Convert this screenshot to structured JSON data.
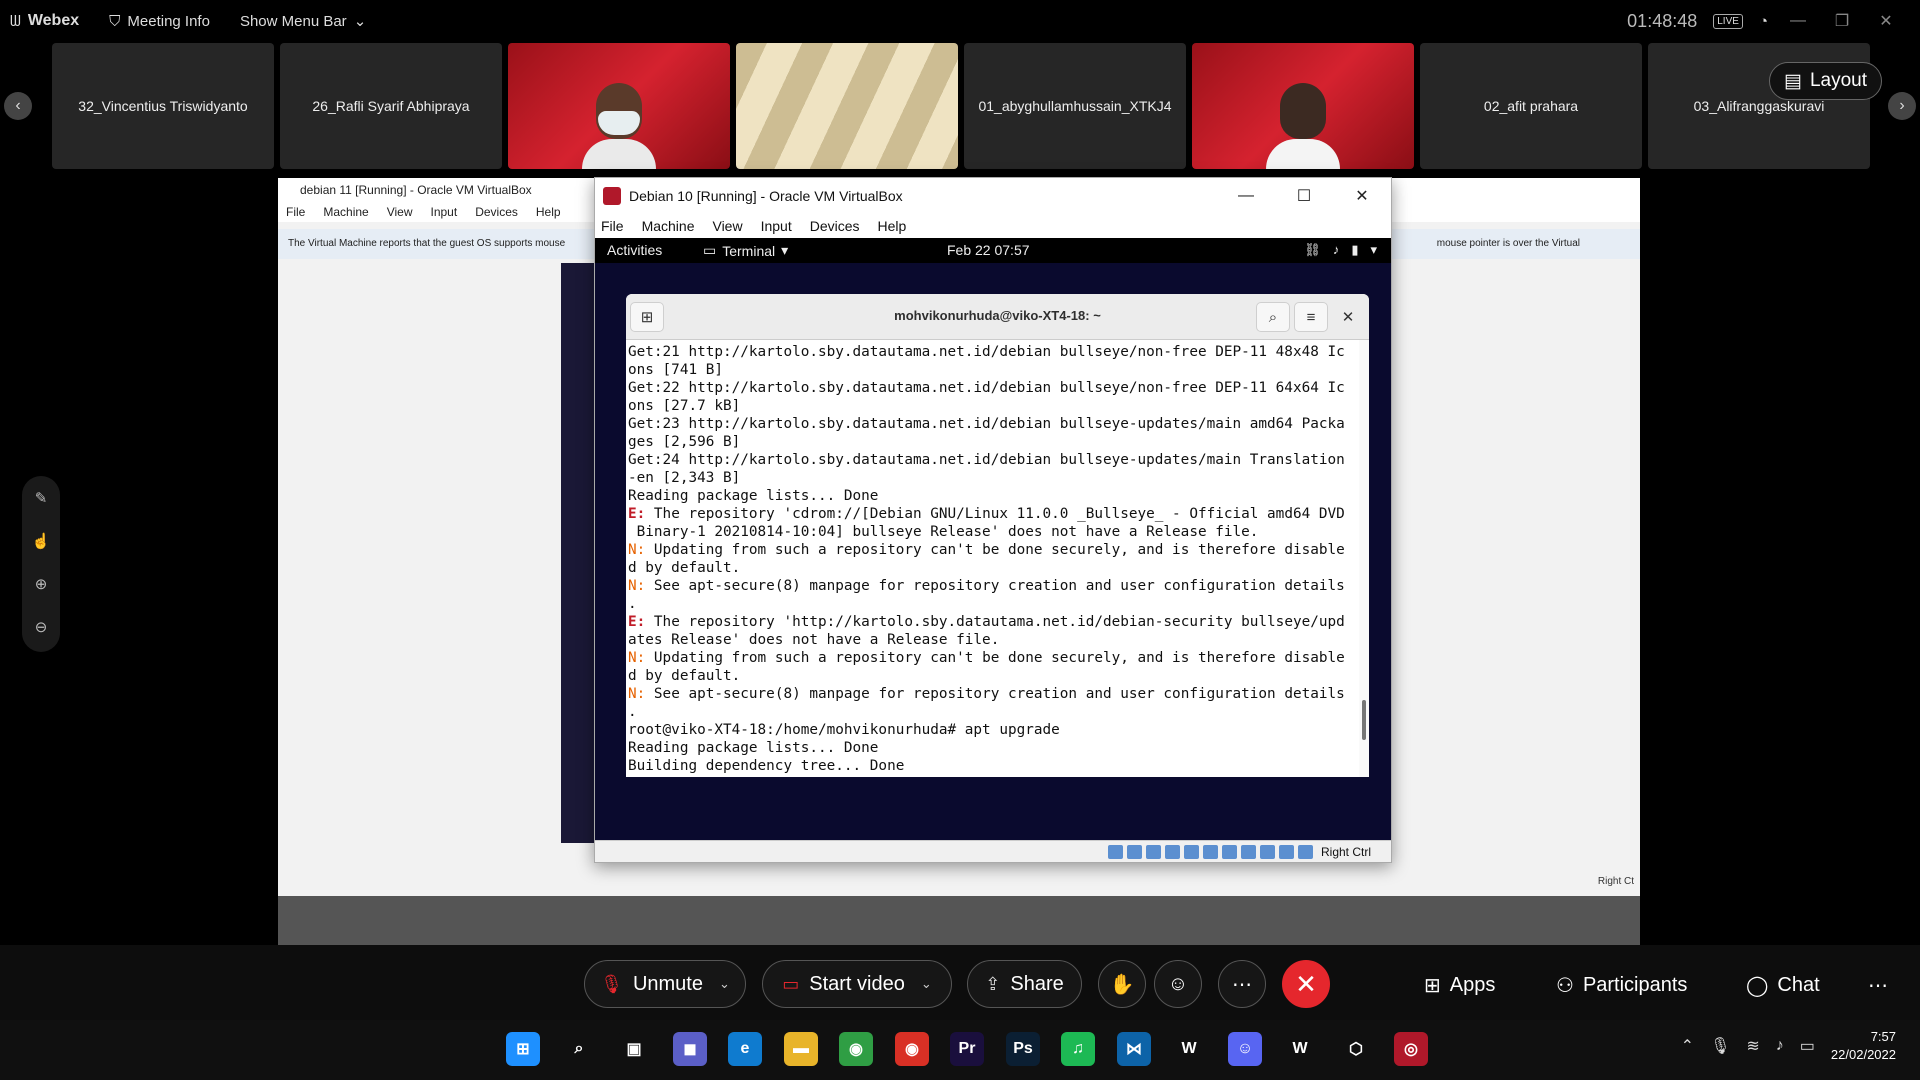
{
  "topbar": {
    "app_name": "Webex",
    "meeting_info": "Meeting Info",
    "show_menu_bar": "Show Menu Bar",
    "elapsed": "01:48:48",
    "live": "LIVE"
  },
  "participants": [
    {
      "name": "32_Vincentius Triswidyanto",
      "video": false
    },
    {
      "name": "26_Rafli Syarif Abhipraya",
      "video": false
    },
    {
      "name": "",
      "video": true,
      "style": "red"
    },
    {
      "name": "",
      "video": true,
      "style": "blur"
    },
    {
      "name": "01_abyghullamhussain_XTKJ4",
      "video": false
    },
    {
      "name": "",
      "video": true,
      "style": "red"
    },
    {
      "name": "02_afit prahara",
      "video": false
    },
    {
      "name": "03_Alifranggaskuravi",
      "video": false
    }
  ],
  "layout_button": "Layout",
  "vm11": {
    "title": "debian 11 [Running] - Oracle VM VirtualBox",
    "menu": [
      "File",
      "Machine",
      "View",
      "Input",
      "Devices",
      "Help"
    ],
    "notice_left": "The Virtual Machine reports that the guest OS supports mouse",
    "notice_right": "mouse pointer is over the Virtual",
    "status_right": "Right Ct"
  },
  "vbox": {
    "title": "Debian 10 [Running] - Oracle VM VirtualBox",
    "menu": [
      "File",
      "Machine",
      "View",
      "Input",
      "Devices",
      "Help"
    ],
    "status_key": "Right Ctrl"
  },
  "gnome": {
    "activities": "Activities",
    "app": "Terminal",
    "clock": "Feb 22  07:57"
  },
  "terminal": {
    "title": "mohvikonurhuda@viko-XT4-18: ~",
    "lines": [
      {
        "t": "Get:21 http://kartolo.sby.datautama.net.id/debian bullseye/non-free DEP-11 48x48 Ic"
      },
      {
        "t": "ons [741 B]"
      },
      {
        "t": "Get:22 http://kartolo.sby.datautama.net.id/debian bullseye/non-free DEP-11 64x64 Ic"
      },
      {
        "t": "ons [27.7 kB]"
      },
      {
        "t": "Get:23 http://kartolo.sby.datautama.net.id/debian bullseye-updates/main amd64 Packa"
      },
      {
        "t": "ges [2,596 B]"
      },
      {
        "t": "Get:24 http://kartolo.sby.datautama.net.id/debian bullseye-updates/main Translation"
      },
      {
        "t": "-en [2,343 B]"
      },
      {
        "t": "Reading package lists... Done"
      },
      {
        "tag": "E:",
        "kind": "e",
        "t": " The repository 'cdrom://[Debian GNU/Linux 11.0.0 _Bullseye_ - Official amd64 DVD"
      },
      {
        "t": " Binary-1 20210814-10:04] bullseye Release' does not have a Release file."
      },
      {
        "tag": "N:",
        "kind": "n",
        "t": " Updating from such a repository can't be done securely, and is therefore disable"
      },
      {
        "t": "d by default."
      },
      {
        "tag": "N:",
        "kind": "n",
        "t": " See apt-secure(8) manpage for repository creation and user configuration details"
      },
      {
        "t": "."
      },
      {
        "tag": "E:",
        "kind": "e",
        "t": " The repository 'http://kartolo.sby.datautama.net.id/debian-security bullseye/upd"
      },
      {
        "t": "ates Release' does not have a Release file."
      },
      {
        "tag": "N:",
        "kind": "n",
        "t": " Updating from such a repository can't be done securely, and is therefore disable"
      },
      {
        "t": "d by default."
      },
      {
        "tag": "N:",
        "kind": "n",
        "t": " See apt-secure(8) manpage for repository creation and user configuration details"
      },
      {
        "t": "."
      },
      {
        "t": "root@viko-XT4-18:/home/mohvikonurhuda# apt upgrade"
      },
      {
        "t": "Reading package lists... Done"
      },
      {
        "t": "Building dependency tree... Done"
      }
    ]
  },
  "controls": {
    "unmute": "Unmute",
    "start_video": "Start video",
    "share": "Share",
    "apps": "Apps",
    "participants": "Participants",
    "chat": "Chat"
  },
  "taskbar": {
    "apps": [
      {
        "name": "start",
        "label": "⊞",
        "color": "#1e90ff"
      },
      {
        "name": "search",
        "label": "⌕",
        "color": "#101010"
      },
      {
        "name": "task-view",
        "label": "▣",
        "color": "#101010"
      },
      {
        "name": "teams",
        "label": "◼",
        "color": "#5b5fc7"
      },
      {
        "name": "edge",
        "label": "e",
        "color": "#0f7bcf"
      },
      {
        "name": "file-explorer",
        "label": "▬",
        "color": "#e8b42a"
      },
      {
        "name": "chrome-profile-m",
        "label": "◉",
        "color": "#2f9e44"
      },
      {
        "name": "chrome",
        "label": "◉",
        "color": "#d93025"
      },
      {
        "name": "premiere-pro",
        "label": "Pr",
        "color": "#1a0f3d"
      },
      {
        "name": "photoshop",
        "label": "Ps",
        "color": "#0b1f33"
      },
      {
        "name": "spotify",
        "label": "♫",
        "color": "#1db954"
      },
      {
        "name": "vscode",
        "label": "⋈",
        "color": "#0d63a8"
      },
      {
        "name": "webex",
        "label": "W",
        "color": "#101010"
      },
      {
        "name": "discord",
        "label": "☺",
        "color": "#5865f2"
      },
      {
        "name": "webex-meetings",
        "label": "W",
        "color": "#101010"
      },
      {
        "name": "virtualbox-3d",
        "label": "⬡",
        "color": "#101010"
      },
      {
        "name": "virtualbox",
        "label": "◎",
        "color": "#b0182a"
      }
    ],
    "time": "7:57",
    "date": "22/02/2022"
  },
  "colors": {
    "end_button": "#e5272d",
    "terminal_error": "#c01c28",
    "terminal_notice": "#e66100"
  }
}
